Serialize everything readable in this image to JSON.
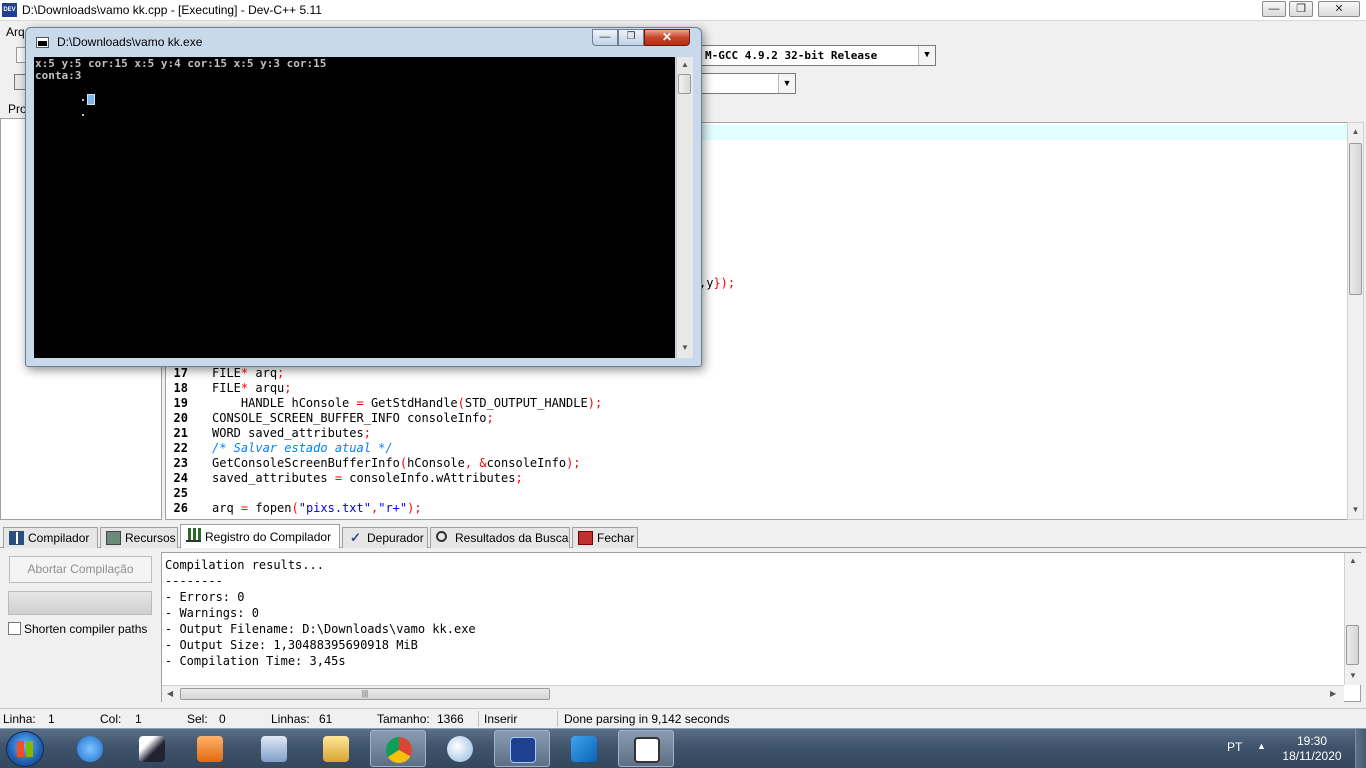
{
  "main_window": {
    "title": "D:\\Downloads\\vamo kk.cpp - [Executing] - Dev-C++ 5.11",
    "icon_text": "DEV",
    "menu_partial": "Arq"
  },
  "toolbar": {
    "compiler_selected": "M-GCC 4.9.2 32-bit Release"
  },
  "left_panel": {
    "tab_label": "Pro"
  },
  "editor": {
    "fragment_text": ",y",
    "fragment_sym": "});",
    "lines": [
      {
        "n": "17",
        "code": "FILE* arq;"
      },
      {
        "n": "18",
        "code": "FILE* arqu;"
      },
      {
        "n": "19",
        "code": "    HANDLE hConsole = GetStdHandle(STD_OUTPUT_HANDLE);"
      },
      {
        "n": "20",
        "code": "CONSOLE_SCREEN_BUFFER_INFO consoleInfo;"
      },
      {
        "n": "21",
        "code": "WORD saved_attributes;"
      },
      {
        "n": "22",
        "code": "/* Salvar estado atual */"
      },
      {
        "n": "23",
        "code": "GetConsoleScreenBufferInfo(hConsole, &consoleInfo);"
      },
      {
        "n": "24",
        "code": "saved_attributes = consoleInfo.wAttributes;"
      },
      {
        "n": "25",
        "code": ""
      },
      {
        "n": "26",
        "code": "arq = fopen(\"pixs.txt\",\"r+\");"
      }
    ]
  },
  "bottom_tabs": [
    {
      "id": "compilador",
      "label": "Compilador"
    },
    {
      "id": "recursos",
      "label": "Recursos"
    },
    {
      "id": "registro",
      "label": "Registro do Compilador"
    },
    {
      "id": "depurador",
      "label": "Depurador"
    },
    {
      "id": "resultados",
      "label": "Resultados da Busca"
    },
    {
      "id": "fechar",
      "label": "Fechar"
    }
  ],
  "bottom_panel": {
    "abort_label": "Abortar Compilação",
    "shorten_label": "Shorten compiler paths",
    "shorten_checked": false,
    "log_lines": [
      "Compilation results...",
      "--------",
      "- Errors: 0",
      "- Warnings: 0",
      "- Output Filename: D:\\Downloads\\vamo kk.exe",
      "- Output Size: 1,30488395690918 MiB",
      "- Compilation Time: 3,45s"
    ]
  },
  "statusbar": {
    "linha_label": "Linha:",
    "linha_value": "1",
    "col_label": "Col:",
    "col_value": "1",
    "sel_label": "Sel:",
    "sel_value": "0",
    "linhas_label": "Linhas:",
    "linhas_value": "61",
    "tamanho_label": "Tamanho:",
    "tamanho_value": "1366",
    "mode": "Inserir",
    "message": "Done parsing in 9,142 seconds"
  },
  "console": {
    "title": "D:\\Downloads\\vamo kk.exe",
    "output_line1": "x:5 y:5 cor:15 x:5 y:4 cor:15 x:5 y:3 cor:15",
    "output_line2": "conta:3"
  },
  "taskbar": {
    "apps": [
      "internet-explorer",
      "bird-app",
      "media-player",
      "file-manager-app",
      "windows-explorer",
      "chrome",
      "paint-app",
      "dev-cpp",
      "vscode",
      "console-window"
    ],
    "lang": "PT",
    "time": "19:30",
    "date": "18/11/2020"
  },
  "colors": {
    "current_line": "#e0ffff",
    "symbol_red": "#ff0000",
    "string_blue": "#0000ff",
    "comment_blue": "#0080ff",
    "console_bg": "#000000",
    "close_red": "#c8452b"
  }
}
